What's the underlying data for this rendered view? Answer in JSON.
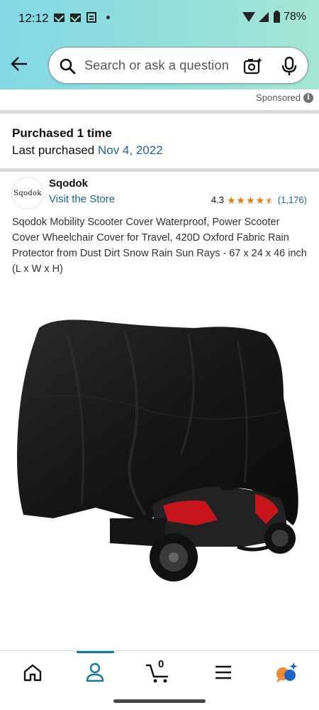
{
  "status_bar": {
    "time": "12:12",
    "battery": "78%"
  },
  "search": {
    "placeholder": "Search or ask a question"
  },
  "sponsored_label": "Sponsored",
  "purchase_info": {
    "purchased": "Purchased 1 time",
    "last_purchased_label": "Last purchased ",
    "last_purchased_date": "Nov 4, 2022"
  },
  "brand": {
    "logo_text": "Sqodok",
    "name": "Sqodok",
    "visit_store": "Visit the Store"
  },
  "rating": {
    "value": "4.3",
    "stars": 4.5,
    "count": "(1,176)"
  },
  "product": {
    "title": "Sqodok Mobility Scooter Cover Waterproof, Power Scooter Cover Wheelchair Cover for Travel, 420D Oxford Fabric Rain Protector from Dust Dirt Snow Rain Sun Rays - 67 x 24 x 46 inch (L x W x H)"
  },
  "bottom_nav": {
    "cart_count": "0",
    "items": [
      "home-icon",
      "account-icon",
      "cart-icon",
      "menu-icon",
      "rufus-icon"
    ]
  },
  "colors": {
    "accent_link": "#2162a1",
    "star": "#e67a00",
    "nav_active": "#127a9b",
    "header_gradient_start": "#82d8e3",
    "header_gradient_end": "#a5e6d3"
  }
}
